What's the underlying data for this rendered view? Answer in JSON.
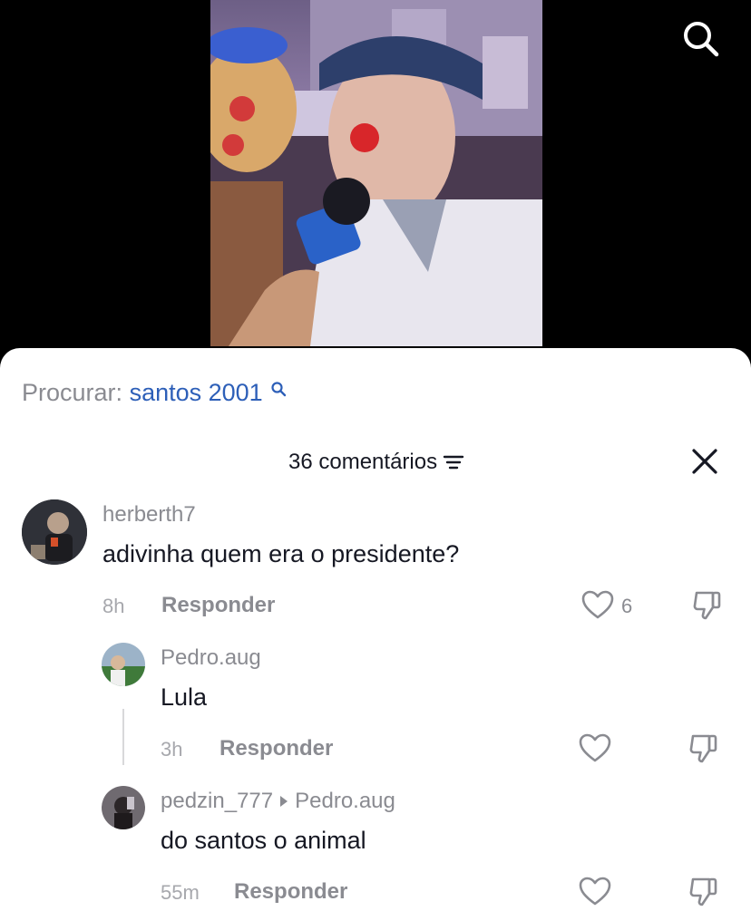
{
  "search_suggestion": {
    "prefix": "Procurar:",
    "term": "santos 2001"
  },
  "header": {
    "comment_count": "36 comentários"
  },
  "icons": {
    "search": "search-icon",
    "sort": "sort-icon",
    "close": "close-icon",
    "like": "heart-icon",
    "dislike": "thumbs-down-icon"
  },
  "colors": {
    "accent": "#2d5fb8",
    "text": "#161823",
    "muted": "#8a8b91"
  },
  "comments": [
    {
      "username": "herberth7",
      "text": "adivinha quem era o presidente?",
      "time": "8h",
      "reply_label": "Responder",
      "likes": "6"
    },
    {
      "username": "Pedro.aug",
      "text": "Lula",
      "time": "3h",
      "reply_label": "Responder"
    },
    {
      "username": "pedzin_777",
      "reply_to": "Pedro.aug",
      "text": "do santos o animal",
      "time": "55m",
      "reply_label": "Responder"
    }
  ]
}
